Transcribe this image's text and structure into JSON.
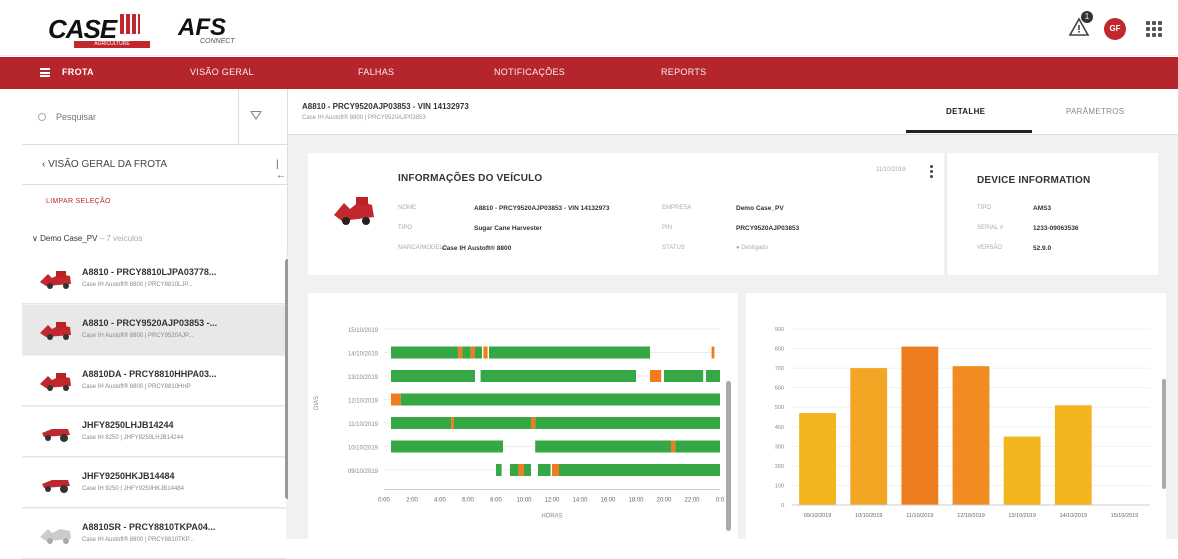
{
  "brand": {
    "case_logo": "CASE",
    "case_sub": "AGRICULTURE",
    "afs_logo": "AFS",
    "afs_sub": "CONNECT"
  },
  "header": {
    "alert_count": "1",
    "avatar_initials": "GF"
  },
  "nav": {
    "items": [
      {
        "label": "FROTA",
        "active": true
      },
      {
        "label": "VISÃO GERAL"
      },
      {
        "label": "FALHAS"
      },
      {
        "label": "NOTIFICAÇÕES"
      },
      {
        "label": "REPORTS"
      }
    ]
  },
  "sidebar": {
    "search_placeholder": "Pesquisar",
    "back_label": "VISÃO GERAL DA FROTA",
    "clear_selection": "LIMPAR SELEÇÃO",
    "group": {
      "name": "Demo Case_PV",
      "count": "7 veículos"
    },
    "vehicles": [
      {
        "name": "A8810 - PRCY8810LJPA03778...",
        "sub": "Case IH Austoft® 8800 | PRCY8810LJP..."
      },
      {
        "name": "A8810 - PRCY9520AJP03853 -...",
        "sub": "Case IH Austoft® 8800 | PRCY9520AJP..."
      },
      {
        "name": "A8810DA - PRCY8810HHPA03...",
        "sub": "Case IH Austoft® 8800 | PRCY8810HHP"
      },
      {
        "name": "JHFY8250LHJB14244",
        "sub": "Case IH 8250 | JHFY8250LHJB14244"
      },
      {
        "name": "JHFY9250HKJB14484",
        "sub": "Case IH 9250 | JHFY9250HKJB14484"
      },
      {
        "name": "A8810SR - PRCY8810TKPA04...",
        "sub": "Case IH Austoft® 8800 | PRCY8810TKP..."
      }
    ]
  },
  "vehicle_header": {
    "title": "A8810 - PRCY9520AJP03853 - VIN 14132973",
    "subtitle": "Case IH Austoft® 8800  |  PRCY9520AJP03853",
    "tabs": [
      "DETALHE",
      "PARÂMETROS"
    ]
  },
  "info": {
    "title": "INFORMAÇÕES DO VEÍCULO",
    "date": "11/10/2019",
    "fields": [
      {
        "label": "NOME",
        "value": "A8810 - PRCY9520AJP03853 - VIN 14132973"
      },
      {
        "label": "TIPO",
        "value": "Sugar Cane Harvester"
      },
      {
        "label": "MARCA/MODELO",
        "value": "Case IH Austoft® 8800"
      },
      {
        "label": "EMPRESA",
        "value": "Demo Case_PV"
      },
      {
        "label": "PIN",
        "value": "PRCY9520AJP03853"
      },
      {
        "label": "STATUS",
        "value": "Desligado"
      }
    ]
  },
  "device": {
    "title": "DEVICE INFORMATION",
    "fields": [
      {
        "label": "TIPO",
        "value": "AMS3"
      },
      {
        "label": "SERIAL #",
        "value": "1233-09063536"
      },
      {
        "label": "VERSÃO",
        "value": "52.9.0"
      }
    ]
  },
  "timeline_chart": {
    "type": "timeline",
    "ylabel": "DIAS",
    "xlabel": "HORAS",
    "days": [
      "15/10/2019",
      "14/10/2019",
      "13/10/2019",
      "12/10/2019",
      "11/10/2019",
      "10/10/2019",
      "09/10/2019"
    ],
    "ticks": [
      "0:00",
      "2:00",
      "4:00",
      "6:00",
      "8:00",
      "10:00",
      "12:00",
      "14:00",
      "16:00",
      "18:00",
      "20:00",
      "22:00",
      "0:0"
    ],
    "colors": {
      "work": "#35a744",
      "idle": "#ef7d1f"
    },
    "segments": [
      [],
      [
        [
          0.5,
          5.3,
          "work"
        ],
        [
          5.3,
          5.6,
          "idle"
        ],
        [
          5.6,
          6.2,
          "work"
        ],
        [
          6.2,
          6.5,
          "idle"
        ],
        [
          6.5,
          7.0,
          "work"
        ],
        [
          7.1,
          7.4,
          "idle"
        ],
        [
          7.5,
          19.0,
          "work"
        ],
        [
          23.4,
          23.6,
          "idle"
        ]
      ],
      [
        [
          0.5,
          6.5,
          "work"
        ],
        [
          6.9,
          18.0,
          "work"
        ],
        [
          19.0,
          19.8,
          "idle"
        ],
        [
          20.0,
          22.8,
          "work"
        ],
        [
          23.0,
          24,
          "work"
        ]
      ],
      [
        [
          0.5,
          1.2,
          "idle"
        ],
        [
          1.2,
          24,
          "work"
        ]
      ],
      [
        [
          0.5,
          4.8,
          "work"
        ],
        [
          4.8,
          5.0,
          "idle"
        ],
        [
          5.0,
          10.5,
          "work"
        ],
        [
          10.5,
          10.8,
          "idle"
        ],
        [
          10.8,
          24,
          "work"
        ]
      ],
      [
        [
          0.5,
          8.5,
          "work"
        ],
        [
          10.8,
          20.5,
          "work"
        ],
        [
          20.5,
          20.8,
          "idle"
        ],
        [
          20.8,
          24,
          "work"
        ]
      ],
      [
        [
          8.0,
          8.4,
          "work"
        ],
        [
          9.0,
          9.6,
          "work"
        ],
        [
          9.6,
          10.0,
          "idle"
        ],
        [
          10.0,
          10.5,
          "work"
        ],
        [
          11.0,
          11.9,
          "work"
        ],
        [
          12.0,
          12.5,
          "idle"
        ],
        [
          12.5,
          24,
          "work"
        ]
      ]
    ]
  },
  "chart_data": {
    "type": "bar",
    "categories": [
      "09/10/2019",
      "10/10/2019",
      "11/10/2019",
      "12/10/2019",
      "13/10/2019",
      "14/10/2019",
      "15/10/2019"
    ],
    "values": [
      470,
      700,
      810,
      710,
      350,
      510,
      0
    ],
    "yticks": [
      "0",
      "100",
      "200",
      "300",
      "400",
      "500",
      "600",
      "700",
      "800",
      "900"
    ],
    "ylim": [
      0,
      900
    ],
    "colors": [
      "#f2b51d",
      "#f2a623",
      "#ee7d1f",
      "#f08c22",
      "#f2b51d",
      "#f2b51d",
      "#f2b51d"
    ],
    "grid": true
  }
}
